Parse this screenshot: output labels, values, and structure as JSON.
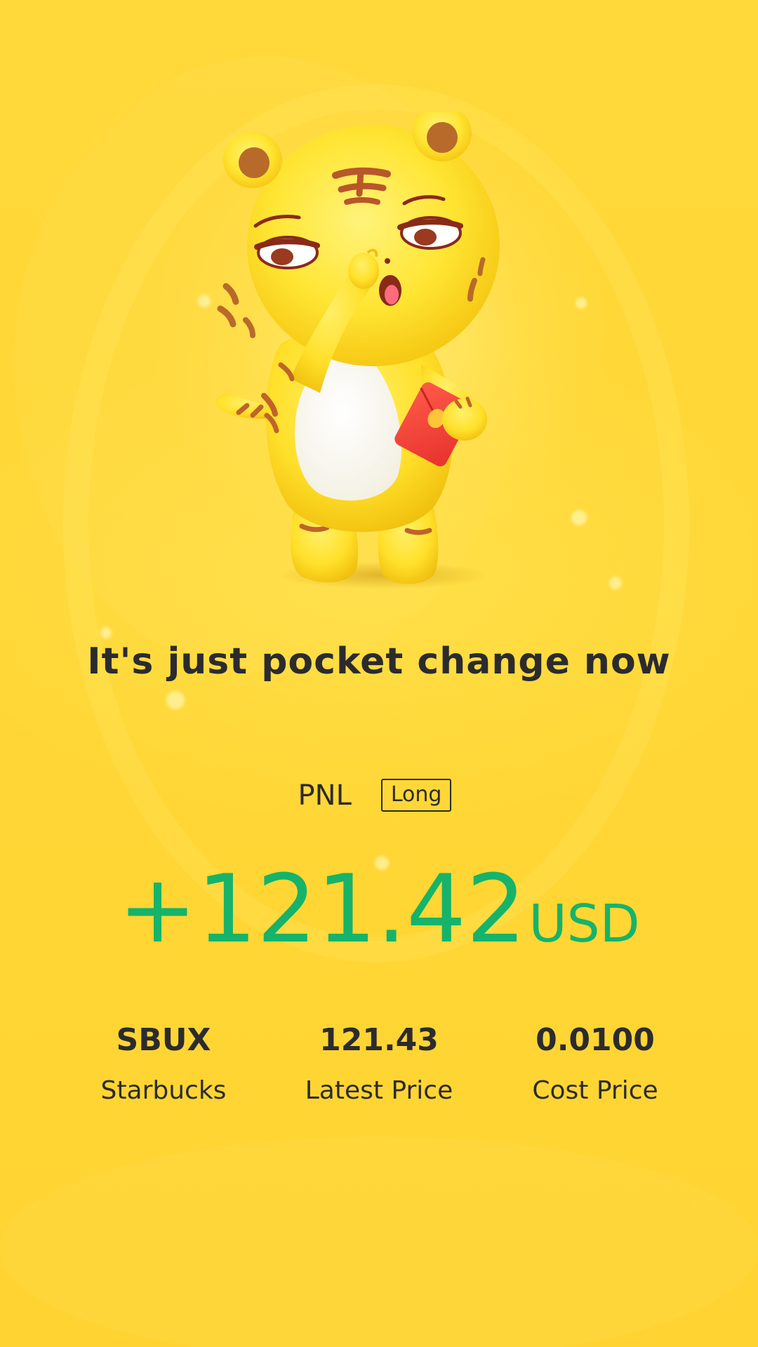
{
  "headline": "It's just pocket change now",
  "pnl": {
    "label": "PNL",
    "direction": "Long",
    "amount": "+121.42",
    "currency": "USD"
  },
  "stats": [
    {
      "value": "SBUX",
      "label": "Starbucks"
    },
    {
      "value": "121.43",
      "label": "Latest Price"
    },
    {
      "value": "0.0100",
      "label": "Cost Price"
    }
  ],
  "colors": {
    "background": "#ffd736",
    "profit_green": "#16b36a",
    "text_dark": "#2b2b2e",
    "envelope_red": "#f0433a"
  },
  "illustration": {
    "name": "tiger-mascot",
    "holding": "red-envelope"
  }
}
